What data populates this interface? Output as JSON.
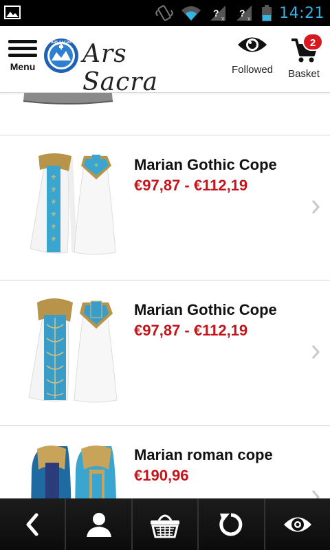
{
  "status_bar": {
    "time": "14:21",
    "icons": [
      "image-notification-icon",
      "vibrate-icon",
      "wifi-icon",
      "no-signal-icon",
      "no-signal-icon",
      "battery-icon"
    ]
  },
  "header": {
    "menu_label": "Menu",
    "logo_text": "Ars Sacra",
    "logo_badge_text": "ARS SACRA",
    "followed_label": "Followed",
    "basket_label": "Basket",
    "basket_count": "2"
  },
  "products": [
    {
      "name": "Marian Gothic Cope",
      "price": "€97,87 - €112,19",
      "variant": "blue-fleur"
    },
    {
      "name": "Marian Gothic Cope",
      "price": "€97,87 - €112,19",
      "variant": "blue-damask"
    },
    {
      "name": "Marian roman cope",
      "price": "€190,96",
      "variant": "roman"
    }
  ],
  "bottom_nav": [
    "back-icon",
    "account-icon",
    "basket-icon",
    "refresh-icon",
    "followed-icon"
  ],
  "colors": {
    "status_accent": "#33b5e5",
    "price_red": "#c4141a",
    "badge_red": "#d71920",
    "vestment_blue": "#3aa6cf",
    "gold": "#b8944a"
  }
}
